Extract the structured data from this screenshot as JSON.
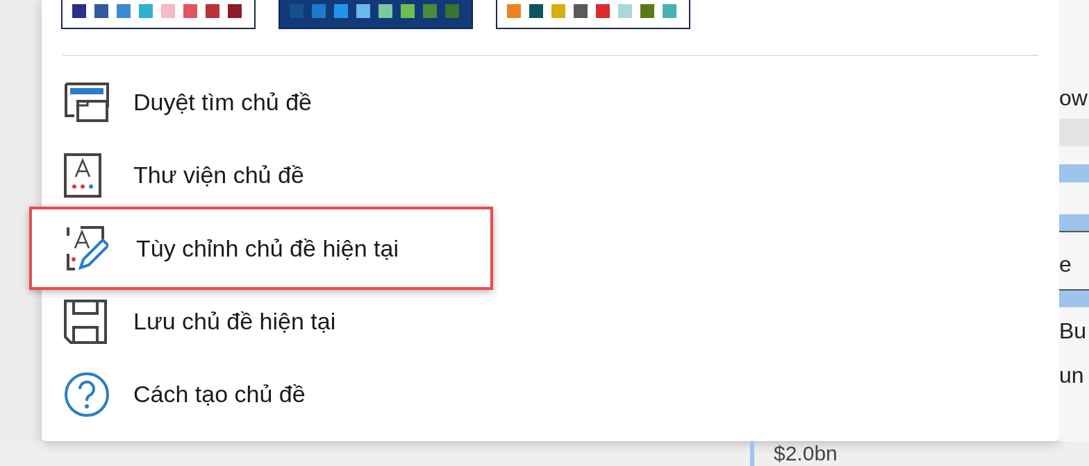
{
  "themes": [
    {
      "kind": "light",
      "swatches": [
        {
          "color": "#2b2f8a"
        },
        {
          "color": "#2f5a9e"
        },
        {
          "color": "#3a8bd0"
        },
        {
          "color": "#2fb0d0"
        },
        {
          "color": "#f7b8c8"
        },
        {
          "color": "#e05560"
        },
        {
          "color": "#b83238"
        },
        {
          "color": "#8e1c26"
        }
      ]
    },
    {
      "kind": "dark",
      "swatches": [
        {
          "color": "#17508a"
        },
        {
          "color": "#1e7ad0"
        },
        {
          "color": "#2394ee"
        },
        {
          "color": "#6ab8f0"
        },
        {
          "color": "#78c8a0"
        },
        {
          "color": "#6cc050"
        },
        {
          "color": "#4a8a3a"
        },
        {
          "color": "#3e7030"
        }
      ]
    },
    {
      "kind": "light",
      "swatches": [
        {
          "color": "#f08020"
        },
        {
          "color": "#0c5560"
        },
        {
          "color": "#d4b010"
        },
        {
          "color": "#5a5a5a"
        },
        {
          "color": "#dd2a2a"
        },
        {
          "color": "#a8d8dc"
        },
        {
          "color": "#5a7a18"
        },
        {
          "color": "#4ab0b0"
        }
      ]
    }
  ],
  "menu_items": [
    {
      "kind": "browse",
      "label": "Duyệt tìm chủ đề",
      "selected": false
    },
    {
      "kind": "gallery",
      "label": "Thư viện chủ đề",
      "selected": false
    },
    {
      "kind": "customize",
      "label": "Tùy chỉnh chủ đề hiện tại",
      "selected": true
    },
    {
      "kind": "save",
      "label": "Lưu chủ đề hiện tại",
      "selected": false
    },
    {
      "kind": "help",
      "label": "Cách tạo chủ đề",
      "selected": false
    }
  ],
  "background_fragments": [
    "ow",
    "e",
    "Bu",
    "un",
    "$2.0bn"
  ]
}
